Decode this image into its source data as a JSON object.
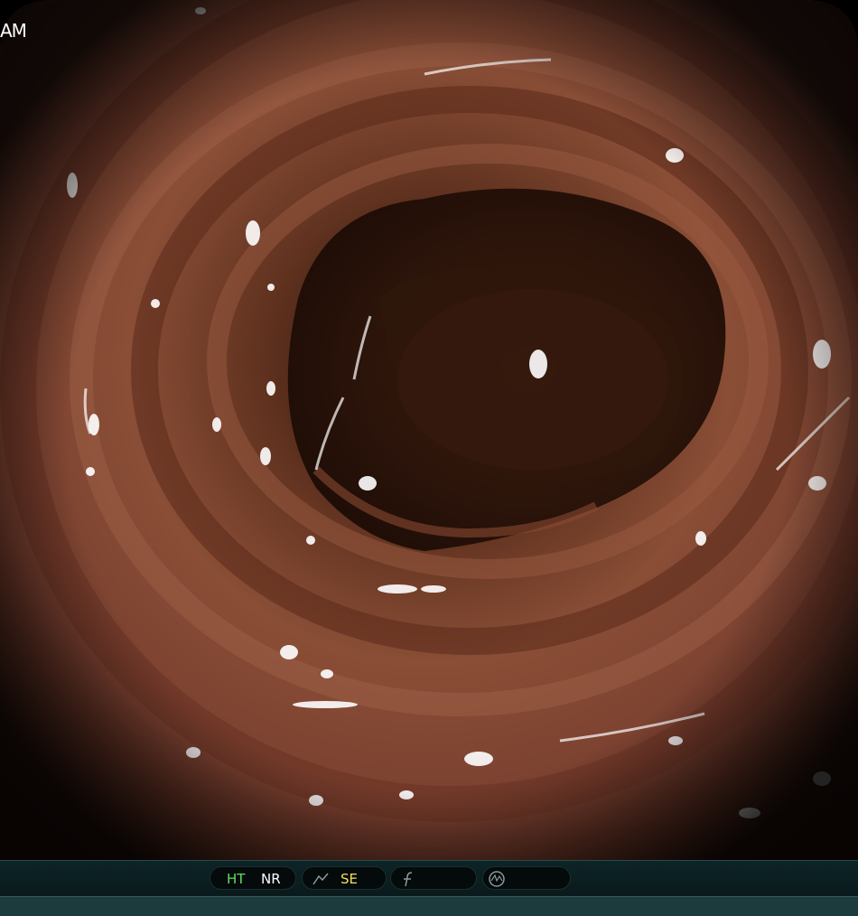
{
  "overlay": {
    "corner_text": "AM"
  },
  "status_bar": {
    "ht_label": "HT",
    "nr_label": "NR",
    "se_label": "SE",
    "colors": {
      "ht": "#5fe05f",
      "nr": "#ffffff",
      "se": "#f2e15a",
      "icon": "#8a9a9a"
    },
    "icons": [
      "contrast-curve-icon",
      "f-stroke-icon",
      "waveform-circle-icon"
    ]
  },
  "image": {
    "description_colors": {
      "mucosa_light": "#9a5a40",
      "mucosa_dark": "#3a1a10",
      "lumen": "#2a1208"
    }
  }
}
